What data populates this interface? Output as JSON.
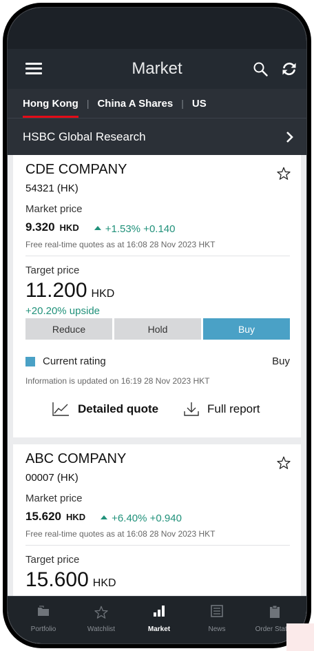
{
  "header": {
    "title": "Market"
  },
  "market_tabs": [
    {
      "label": "Hong Kong",
      "active": true
    },
    {
      "label": "China A Shares",
      "active": false
    },
    {
      "label": "US",
      "active": false
    }
  ],
  "research": {
    "label": "HSBC Global Research"
  },
  "cards": [
    {
      "company": "CDE COMPANY",
      "code": "54321 (HK)",
      "market_price_label": "Market price",
      "price": "9.320",
      "currency": "HKD",
      "change": "+1.53% +0.140",
      "quote_note": "Free real-time quotes as at 16:08 28 Nov 2023 HKT",
      "target_price_label": "Target price",
      "target_price": "11.200",
      "target_currency": "HKD",
      "upside": "+20.20% upside",
      "rating_options": [
        "Reduce",
        "Hold",
        "Buy"
      ],
      "selected_rating": "Buy",
      "current_rating_label": "Current rating",
      "current_rating_value": "Buy",
      "info_note": "Information is updated on 16:19 28 Nov 2023 HKT",
      "detailed_quote_label": "Detailed quote",
      "full_report_label": "Full report"
    },
    {
      "company": "ABC COMPANY",
      "code": "00007 (HK)",
      "market_price_label": "Market price",
      "price": "15.620",
      "currency": "HKD",
      "change": "+6.40% +0.940",
      "quote_note": "Free real-time quotes as at 16:08 28 Nov 2023 HKT",
      "target_price_label": "Target price",
      "target_price": "15.600",
      "target_currency": "HKD"
    }
  ],
  "tab_bar": [
    {
      "label": "Portfolio",
      "icon": "folder-icon",
      "active": false
    },
    {
      "label": "Watchlist",
      "icon": "star-icon",
      "active": false
    },
    {
      "label": "Market",
      "icon": "bar-chart-icon",
      "active": true
    },
    {
      "label": "News",
      "icon": "newspaper-icon",
      "active": false
    },
    {
      "label": "Order Status",
      "icon": "clipboard-icon",
      "active": false
    }
  ],
  "colors": {
    "header_bg": "#242a31",
    "active_tab_underline": "#e40b17",
    "positive_change": "#20917a",
    "rating_selected": "#4aa1c6"
  }
}
